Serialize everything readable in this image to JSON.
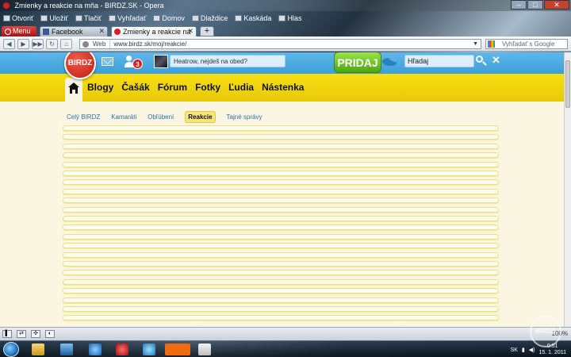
{
  "window": {
    "title": "Zmienky a reakcie na mňa - BIRDZ.SK - Opera"
  },
  "bookmarks": [
    {
      "label": "Otvoriť",
      "icon": "folder-icon"
    },
    {
      "label": "Uložiť",
      "icon": "save-icon"
    },
    {
      "label": "Tlačiť",
      "icon": "print-icon"
    },
    {
      "label": "Vyhľadať",
      "icon": "search-icon"
    },
    {
      "label": "Domov",
      "icon": "home-icon"
    },
    {
      "label": "Dlaždice",
      "icon": "tile-icon"
    },
    {
      "label": "Kaskáda",
      "icon": "cascade-icon"
    },
    {
      "label": "Hlas",
      "icon": "voice-icon"
    }
  ],
  "menu_button": "Menu",
  "tabs": [
    {
      "label": "Facebook",
      "active": false,
      "color": "#3b5998"
    },
    {
      "label": "Zmienky a reakcie na ...",
      "active": true,
      "color": "#d62020"
    }
  ],
  "address": {
    "web_label": "Web",
    "url": "www.birdz.sk/moj/reakcie/",
    "search_placeholder": "Vyhľadať s Google"
  },
  "site": {
    "logo_text": "BIRDZ",
    "notification_count": "3",
    "status_text": "Heatrow, nejdeš na obed?",
    "pridaj_label": "PRIDAJ",
    "search_value": "Hľadaj",
    "nav": [
      "Blogy",
      "Čašák",
      "Fórum",
      "Fotky",
      "Ľudia",
      "Nástenka"
    ],
    "subtabs": [
      {
        "label": "Celý BIRDZ",
        "active": false
      },
      {
        "label": "Kamaráti",
        "active": false
      },
      {
        "label": "Obľúbení",
        "active": false
      },
      {
        "label": "Reakcie",
        "active": true
      },
      {
        "label": "Tajné správy",
        "active": false
      }
    ],
    "colors": {
      "blue_bar": "#4aaae0",
      "yellow_nav": "#f3d510",
      "page_bg": "#fbf6e2",
      "pridaj_green": "#6cc52a"
    }
  },
  "feed_rows_count": 22,
  "statusbar": {
    "zoom": "100%"
  },
  "taskbar": {
    "language": "SK",
    "time": "0:51",
    "date": "15. 1. 2011",
    "watermark": "BIRDZ"
  }
}
